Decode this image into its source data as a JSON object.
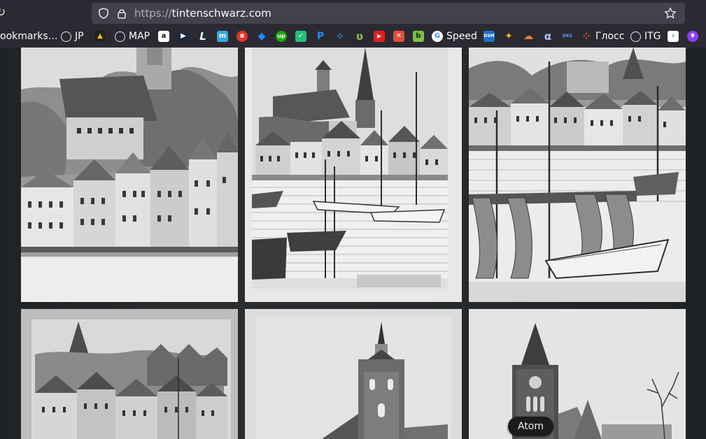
{
  "browser": {
    "url_scheme": "https://",
    "url_host": "tintenschwarz.com"
  },
  "bookmarks": [
    {
      "label": "ookmarks…",
      "icon": "bookmarks-folder-partial"
    },
    {
      "label": "JP",
      "icon": "globe-icon"
    },
    {
      "label": "",
      "icon": "penguin-icon"
    },
    {
      "label": "MAP",
      "icon": "globe-icon"
    },
    {
      "label": "",
      "icon": "amazon-icon"
    },
    {
      "label": "",
      "icon": "play-icon"
    },
    {
      "label": "",
      "icon": "l-icon"
    },
    {
      "label": "",
      "icon": "m-icon"
    },
    {
      "label": "",
      "icon": "yandex-icon"
    },
    {
      "label": "",
      "icon": "dropbox-icon"
    },
    {
      "label": "",
      "icon": "upwork-icon"
    },
    {
      "label": "",
      "icon": "check-icon"
    },
    {
      "label": "",
      "icon": "paypal-icon"
    },
    {
      "label": "",
      "icon": "puzzle-icon"
    },
    {
      "label": "",
      "icon": "leaf-icon"
    },
    {
      "label": "",
      "icon": "youtube-icon"
    },
    {
      "label": "",
      "icon": "cross-icon"
    },
    {
      "label": "",
      "icon": "b-icon"
    },
    {
      "label": "Speed",
      "icon": "google-icon"
    },
    {
      "label": "",
      "icon": "dsm-icon"
    },
    {
      "label": "",
      "icon": "figure-icon"
    },
    {
      "label": "",
      "icon": "cloud-icon"
    },
    {
      "label": "",
      "icon": "alpha-icon"
    },
    {
      "label": "",
      "icon": "dks-icon"
    },
    {
      "label": "Глосс",
      "icon": "dots-icon"
    },
    {
      "label": "ITG",
      "icon": "globe-icon"
    },
    {
      "label": "",
      "icon": "arrow-icon"
    },
    {
      "label": "",
      "icon": "shield-purple-icon"
    }
  ],
  "tooltip": {
    "text": "Atom"
  },
  "colors": {
    "chrome_bg": "#2b2a33",
    "urlbar_bg": "#42414d",
    "page_bg": "#24282a"
  },
  "gallery": {
    "tiles": [
      {
        "name": "sketch-town-hillside"
      },
      {
        "name": "sketch-harbor-church-sailboats"
      },
      {
        "name": "sketch-harbor-nets-boats"
      },
      {
        "name": "sketch-church-rooftops"
      },
      {
        "name": "sketch-church-tower-baroque"
      },
      {
        "name": "sketch-church-brick-tree"
      }
    ]
  }
}
